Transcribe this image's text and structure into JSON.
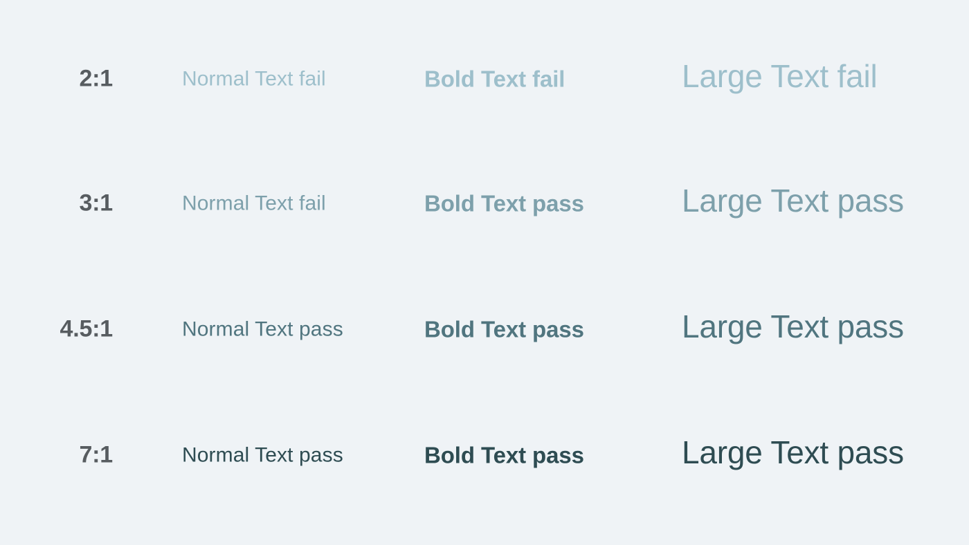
{
  "background_color": "#eff3f6",
  "ratio_label_color": "#575c60",
  "columns": [
    {
      "key": "ratio",
      "name": "contrast-ratio"
    },
    {
      "key": "normal",
      "name": "normal-text-sample"
    },
    {
      "key": "bold",
      "name": "bold-text-sample"
    },
    {
      "key": "large",
      "name": "large-text-sample"
    }
  ],
  "rows": [
    {
      "ratio": "2:1",
      "sample_color": "#9dbfcb",
      "normal": "Normal Text fail",
      "bold": "Bold Text fail",
      "large": "Large Text fail",
      "normal_result": "fail",
      "bold_result": "fail",
      "large_result": "fail"
    },
    {
      "ratio": "3:1",
      "sample_color": "#7da0ab",
      "normal": "Normal Text fail",
      "bold": "Bold Text pass",
      "large": "Large Text pass",
      "normal_result": "fail",
      "bold_result": "pass",
      "large_result": "pass"
    },
    {
      "ratio": "4.5:1",
      "sample_color": "#50757f",
      "normal": "Normal Text pass",
      "bold": "Bold Text pass",
      "large": "Large Text pass",
      "normal_result": "pass",
      "bold_result": "pass",
      "large_result": "pass"
    },
    {
      "ratio": "7:1",
      "sample_color": "#2e4c52",
      "normal": "Normal Text pass",
      "bold": "Bold Text pass",
      "large": "Large Text pass",
      "normal_result": "pass",
      "bold_result": "pass",
      "large_result": "pass"
    }
  ]
}
